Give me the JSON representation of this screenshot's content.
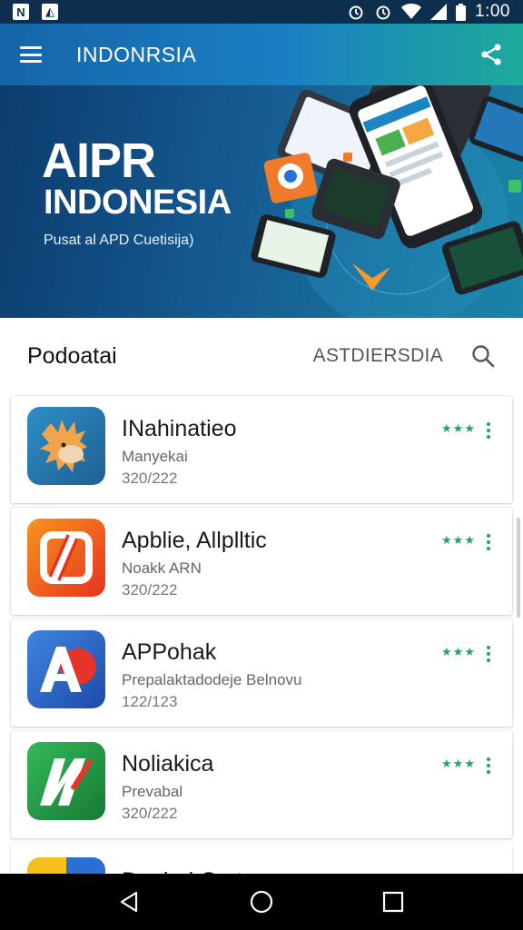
{
  "status_bar": {
    "left_badges": [
      "N",
      "◭"
    ],
    "time": "1:00",
    "icons": [
      "alarm-icon",
      "alarm-icon",
      "wifi-icon",
      "signal-icon",
      "battery-icon"
    ]
  },
  "app_bar": {
    "title": "INDONRSIA",
    "menu_icon": "hamburger-menu-icon",
    "share_icon": "share-icon"
  },
  "hero": {
    "title": "AIPR",
    "subtitle": "INDONESIA",
    "tagline": "Pusat al APD Cuetisija)"
  },
  "section": {
    "title": "Podoatai",
    "filter_label": "ASTDIERSDIA",
    "search_icon": "search-icon"
  },
  "apps": [
    {
      "name": "INahinatieo",
      "developer": "Manyekai",
      "date": "320/222",
      "rating_stars": "★★★",
      "icon": "dragon-app-icon",
      "colors": [
        "#1f6fa8",
        "#2d8fc7"
      ]
    },
    {
      "name": "Apblie, Allplltic",
      "developer": "Noakk ARN",
      "date": "320/222",
      "rating_stars": "★★★",
      "icon": "slash-a-app-icon",
      "colors": [
        "#f04a23",
        "#f7941d"
      ]
    },
    {
      "name": "APPohak",
      "developer": "Prepalaktadodeje Belnovu",
      "date": "122/123",
      "rating_stars": "★★★",
      "icon": "ap-app-icon",
      "colors": [
        "#2457b8",
        "#3f86e0"
      ]
    },
    {
      "name": "Noliakica",
      "developer": "Prevabal",
      "date": "320/222",
      "rating_stars": "★★★",
      "icon": "n-app-icon",
      "colors": [
        "#1d8f3c",
        "#2fb456"
      ]
    }
  ],
  "partial_app": {
    "name": "Dauhal Oa:t",
    "icon": "partial-app-icon"
  },
  "nav_bar": {
    "icons": [
      "back-icon",
      "home-icon",
      "recents-icon"
    ]
  },
  "accent_color": "#1fa463"
}
